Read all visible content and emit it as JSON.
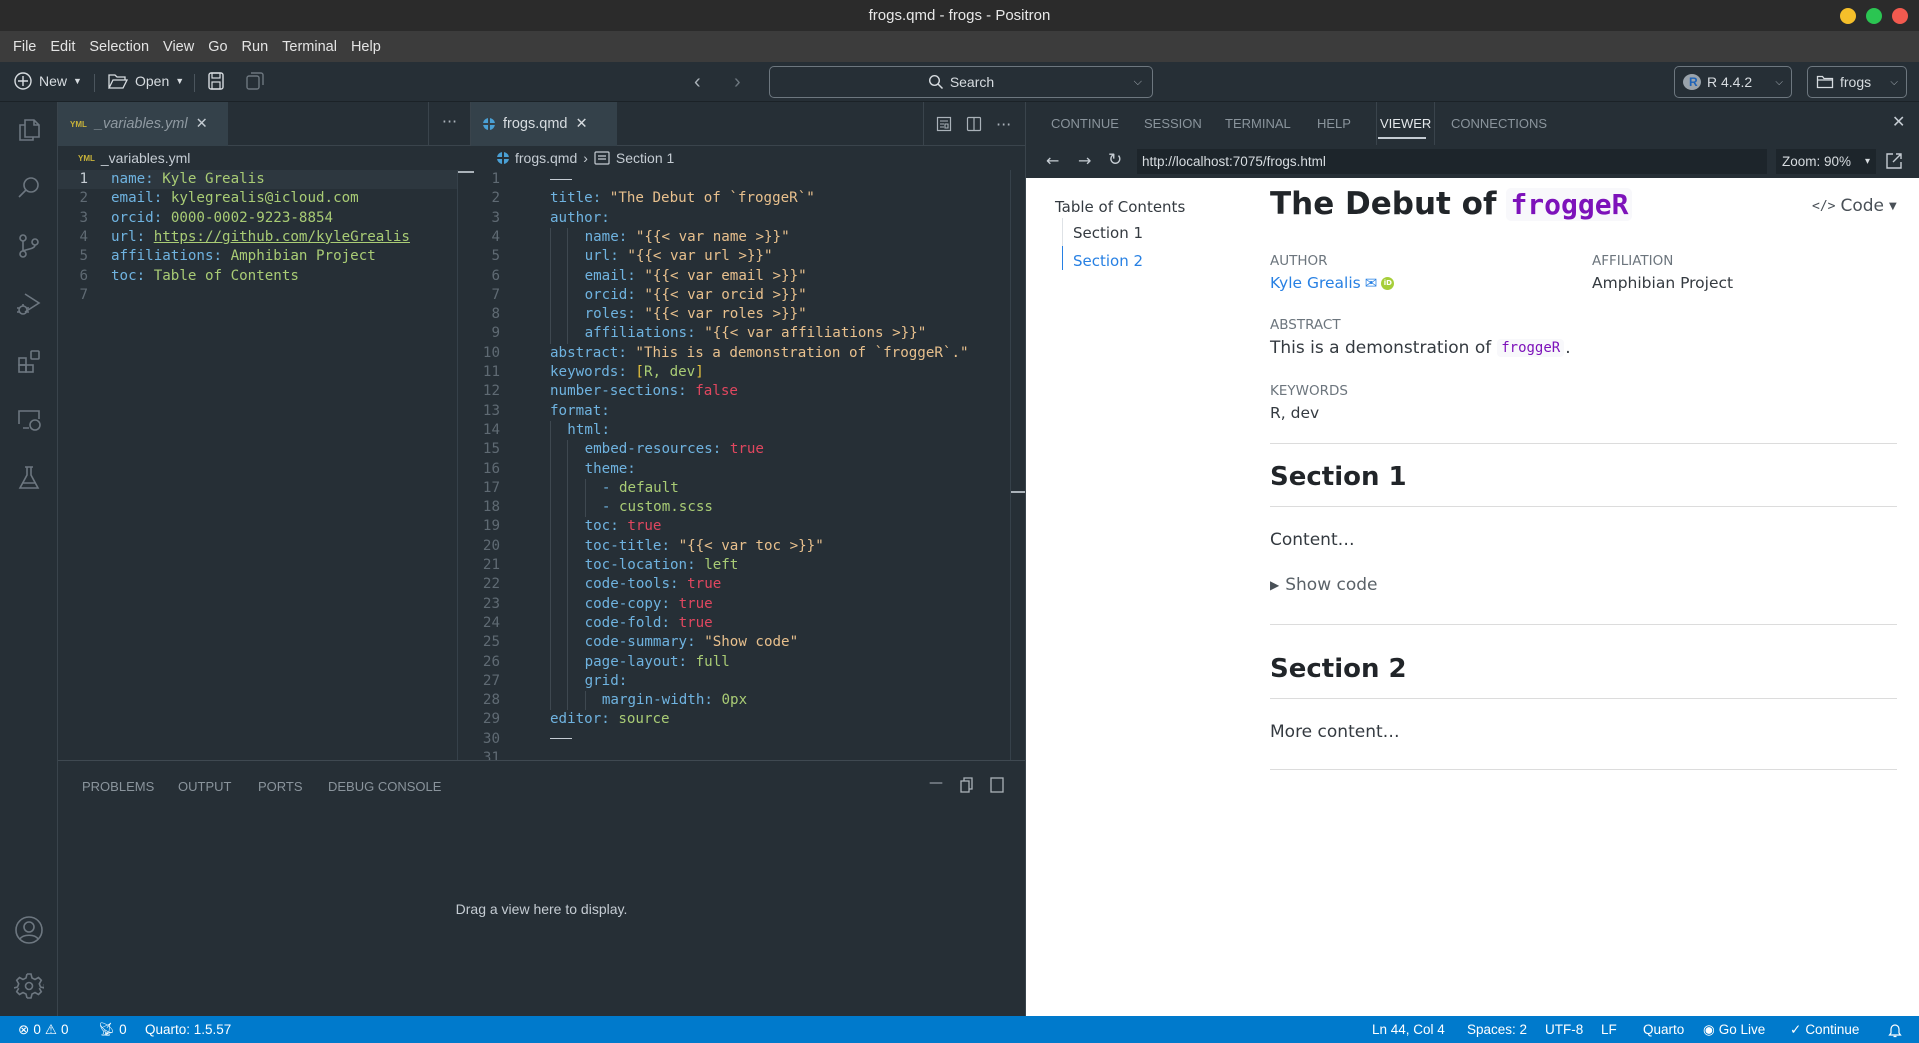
{
  "window": {
    "title": "frogs.qmd - frogs - Positron"
  },
  "menu": [
    "File",
    "Edit",
    "Selection",
    "View",
    "Go",
    "Run",
    "Terminal",
    "Help"
  ],
  "toolbar": {
    "new_label": "New",
    "open_label": "Open",
    "search_placeholder": "Search",
    "interpreter": "R 4.4.2",
    "project": "frogs"
  },
  "activity_bar": [
    "explorer-icon",
    "search-icon",
    "source-control-icon",
    "run-debug-icon",
    "extensions-icon",
    "remote-explorer-icon",
    "testing-icon",
    "accounts-icon",
    "settings-gear-icon"
  ],
  "left_editor": {
    "tab_label": "_variables.yml",
    "breadcrumb": "_variables.yml",
    "lines": [
      {
        "n": "1",
        "key": "name",
        "val": "Kyle Grealis"
      },
      {
        "n": "2",
        "key": "email",
        "val": "kylegrealis@icloud.com"
      },
      {
        "n": "3",
        "key": "orcid",
        "val": "0000-0002-9223-8854"
      },
      {
        "n": "4",
        "key": "url",
        "val": "https://github.com/kyleGrealis"
      },
      {
        "n": "5",
        "key": "affiliations",
        "val": "Amphibian Project"
      },
      {
        "n": "6",
        "key": "toc",
        "val": "Table of Contents"
      },
      {
        "n": "7",
        "key": "",
        "val": ""
      }
    ]
  },
  "right_editor": {
    "tab_label": "frogs.qmd",
    "breadcrumb_file": "frogs.qmd",
    "breadcrumb_section": "Section 1",
    "lines": [
      {
        "n": "1",
        "indent": 0,
        "key": "",
        "val": "---",
        "t": "dash"
      },
      {
        "n": "2",
        "indent": 0,
        "key": "title",
        "val": "\"The Debut of `froggeR`\"",
        "t": "s"
      },
      {
        "n": "3",
        "indent": 0,
        "key": "author",
        "val": "",
        "t": ""
      },
      {
        "n": "4",
        "indent": 2,
        "key": "name",
        "val": "\"{{< var name >}}\"",
        "t": "s"
      },
      {
        "n": "5",
        "indent": 2,
        "key": "url",
        "val": "\"{{< var url >}}\"",
        "t": "s"
      },
      {
        "n": "6",
        "indent": 2,
        "key": "email",
        "val": "\"{{< var email >}}\"",
        "t": "s"
      },
      {
        "n": "7",
        "indent": 2,
        "key": "orcid",
        "val": "\"{{< var orcid >}}\"",
        "t": "s"
      },
      {
        "n": "8",
        "indent": 2,
        "key": "roles",
        "val": "\"{{< var roles >}}\"",
        "t": "s"
      },
      {
        "n": "9",
        "indent": 2,
        "key": "affiliations",
        "val": "\"{{< var affiliations >}}\"",
        "t": "s"
      },
      {
        "n": "10",
        "indent": 0,
        "key": "abstract",
        "val": "\"This is a demonstration of `froggeR`.\"",
        "t": "s"
      },
      {
        "n": "11",
        "indent": 0,
        "key": "keywords",
        "val": "[R, dev]",
        "t": "list"
      },
      {
        "n": "12",
        "indent": 0,
        "key": "number-sections",
        "val": "false",
        "t": "b"
      },
      {
        "n": "13",
        "indent": 0,
        "key": "format",
        "val": "",
        "t": ""
      },
      {
        "n": "14",
        "indent": 1,
        "key": "html",
        "val": "",
        "t": ""
      },
      {
        "n": "15",
        "indent": 2,
        "key": "embed-resources",
        "val": "true",
        "t": "b"
      },
      {
        "n": "16",
        "indent": 2,
        "key": "theme",
        "val": "",
        "t": ""
      },
      {
        "n": "17",
        "indent": 3,
        "key": "",
        "val": "- default",
        "t": "item"
      },
      {
        "n": "18",
        "indent": 3,
        "key": "",
        "val": "- custom.scss",
        "t": "item"
      },
      {
        "n": "19",
        "indent": 2,
        "key": "toc",
        "val": "true",
        "t": "b"
      },
      {
        "n": "20",
        "indent": 2,
        "key": "toc-title",
        "val": "\"{{< var toc >}}\"",
        "t": "s"
      },
      {
        "n": "21",
        "indent": 2,
        "key": "toc-location",
        "val": "left",
        "t": "v"
      },
      {
        "n": "22",
        "indent": 2,
        "key": "code-tools",
        "val": "true",
        "t": "b"
      },
      {
        "n": "23",
        "indent": 2,
        "key": "code-copy",
        "val": "true",
        "t": "b"
      },
      {
        "n": "24",
        "indent": 2,
        "key": "code-fold",
        "val": "true",
        "t": "b"
      },
      {
        "n": "25",
        "indent": 2,
        "key": "code-summary",
        "val": "\"Show code\"",
        "t": "s"
      },
      {
        "n": "26",
        "indent": 2,
        "key": "page-layout",
        "val": "full",
        "t": "v"
      },
      {
        "n": "27",
        "indent": 2,
        "key": "grid",
        "val": "",
        "t": ""
      },
      {
        "n": "28",
        "indent": 3,
        "key": "margin-width",
        "val": "0px",
        "t": "v"
      },
      {
        "n": "29",
        "indent": 0,
        "key": "editor",
        "val": "source",
        "t": "v"
      },
      {
        "n": "30",
        "indent": 0,
        "key": "",
        "val": "---",
        "t": "dash"
      }
    ]
  },
  "panel": {
    "tabs": [
      "PROBLEMS",
      "OUTPUT",
      "PORTS",
      "DEBUG CONSOLE"
    ],
    "empty_message": "Drag a view here to display."
  },
  "right_pane": {
    "tabs": [
      "CONTINUE",
      "SESSION",
      "TERMINAL",
      "HELP",
      "VIEWER",
      "CONNECTIONS"
    ],
    "active_tab": "VIEWER",
    "url": "http://localhost:7075/frogs.html",
    "zoom": "Zoom: 90%"
  },
  "viewer": {
    "toc_title": "Table of Contents",
    "toc_items": [
      "Section 1",
      "Section 2"
    ],
    "toc_active": "Section 2",
    "title_prefix": "The Debut of",
    "title_code": "froggeR",
    "code_button": "Code",
    "author_label": "AUTHOR",
    "author_name": "Kyle Grealis",
    "affiliation_label": "AFFILIATION",
    "affiliation": "Amphibian Project",
    "abstract_label": "ABSTRACT",
    "abstract_text": "This is a demonstration of",
    "abstract_code": "froggeR",
    "abstract_end": ".",
    "keywords_label": "KEYWORDS",
    "keywords": "R, dev",
    "section1_title": "Section 1",
    "section1_content": "Content…",
    "show_code": "Show code",
    "section2_title": "Section 2",
    "section2_content": "More content…",
    "colors": {
      "link": "#2780e3",
      "code": "#7d12ba"
    }
  },
  "statusbar": {
    "errors": "0",
    "warnings": "0",
    "ports": "0",
    "quarto_version": "Quarto: 1.5.57",
    "position": "Ln 44, Col 4",
    "spaces": "Spaces: 2",
    "encoding": "UTF-8",
    "eol": "LF",
    "language": "Quarto",
    "go_live": "Go Live",
    "continue": "Continue"
  }
}
